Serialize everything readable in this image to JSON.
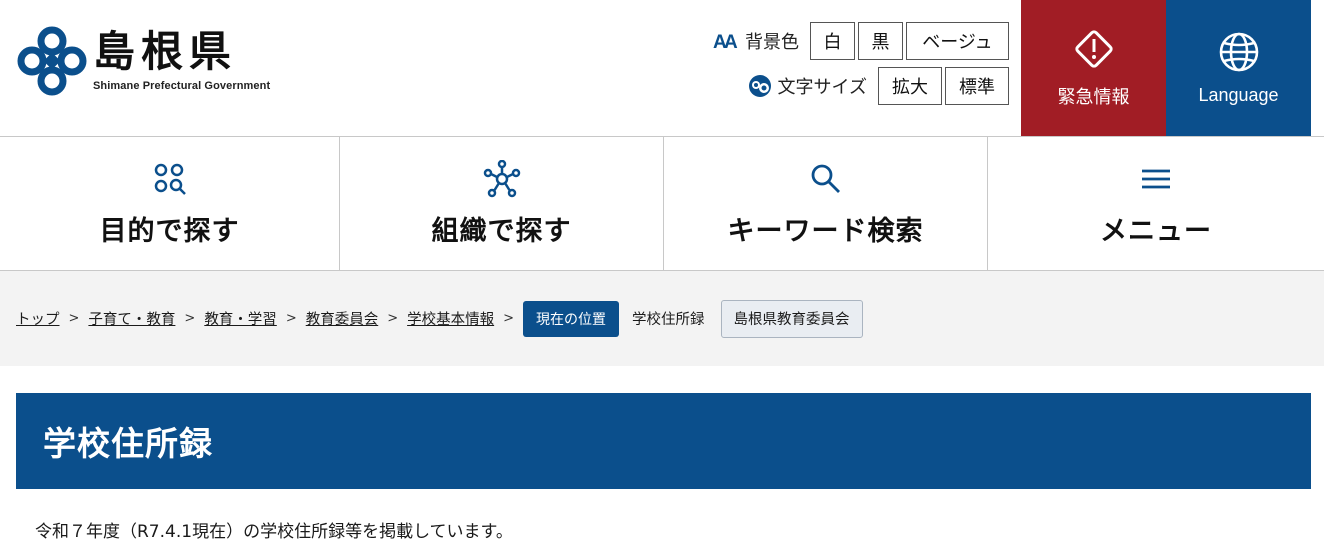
{
  "header": {
    "logo_jp": "島根県",
    "logo_en": "Shimane Prefectural Government",
    "bg_color_label": "背景色",
    "bg_color_options": [
      "白",
      "黒",
      "ベージュ"
    ],
    "font_size_label": "文字サイズ",
    "font_size_options": [
      "拡大",
      "標準"
    ],
    "emergency_label": "緊急情報",
    "language_label": "Language",
    "colors": {
      "emergency": "#a11d25",
      "brand": "#0b4f8c"
    }
  },
  "nav": {
    "items": [
      {
        "label": "目的で探す",
        "icon": "search-by-purpose-icon"
      },
      {
        "label": "組織で探す",
        "icon": "organization-network-icon"
      },
      {
        "label": "キーワード検索",
        "icon": "magnifier-icon"
      },
      {
        "label": "メニュー",
        "icon": "hamburger-menu-icon"
      }
    ]
  },
  "breadcrumb": {
    "links": [
      "トップ",
      "子育て・教育",
      "教育・学習",
      "教育委員会",
      "学校基本情報"
    ],
    "separator": ">",
    "current_label": "現在の位置",
    "current": "学校住所録",
    "department": "島根県教育委員会"
  },
  "page": {
    "title": "学校住所録",
    "intro": "令和７年度（R7.4.1現在）の学校住所録等を掲載しています。"
  }
}
